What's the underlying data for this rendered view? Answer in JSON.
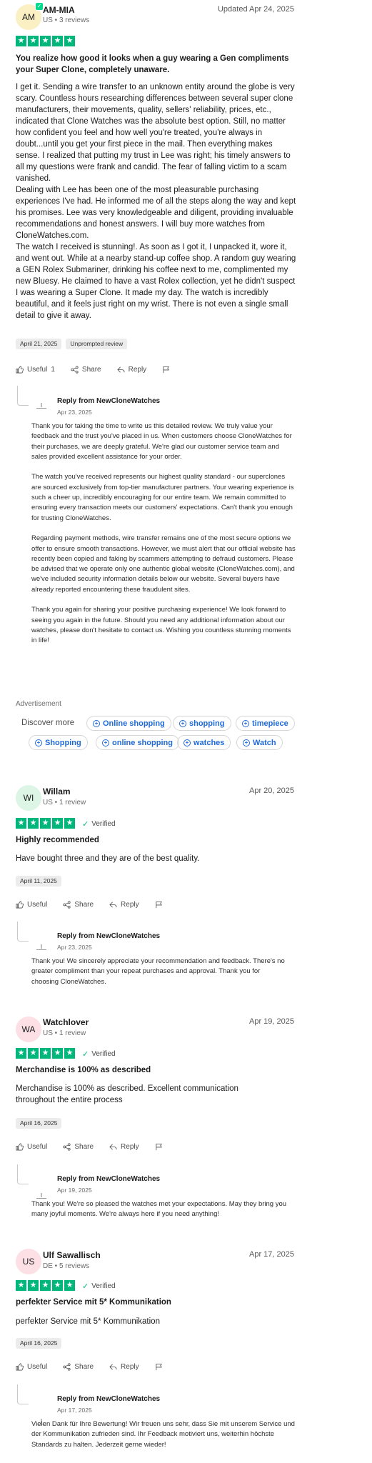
{
  "review1": {
    "initials": "AM",
    "name": "AM-MIA",
    "meta": "US • 3 reviews",
    "date": "Updated Apr 24, 2025",
    "rating": 5,
    "title": "You realize how good it looks when a guy wearing a Gen compliments your Super Clone, completely unaware.",
    "body": "I get it. Sending a wire transfer to an unknown entity around the globe is very scary. Countless hours researching differences between several super clone manufacturers, their movements, quality, sellers' reliability, prices, etc., indicated that Clone Watches was the absolute best option. Still, no matter how confident you feel and how well you're treated, you're always in doubt...until you get your first piece in the mail. Then everything makes sense. I realized that putting my trust in Lee was right; his timely answers to all my questions were frank and candid. The fear of falling victim to a scam vanished.\nDealing with Lee has been one of the most pleasurable purchasing experiences I've had. He informed me of all the steps along the way and kept his promises. Lee was very knowledgeable and diligent, providing invaluable recommendations and honest answers. I will buy more watches from CloneWatches.com.\nThe watch I received is stunning!. As soon as I got it, I unpacked it, wore it, and went out. While at a nearby stand-up coffee shop. A random guy wearing a GEN Rolex Submariner, drinking his coffee next to me, complimented my new Bluesy. He claimed to have a vast Rolex collection, yet he didn't suspect I was wearing a Super Clone. It made my day. The watch is incredibly beautiful, and it feels just right on my wrist. There is not even a single small detail to give it away.",
    "exp_date": "April 21, 2025",
    "tag": "Unprompted review",
    "useful_label": "Useful",
    "useful_count": "1",
    "share": "Share",
    "reply": "Reply",
    "reply_from": "Reply from NewCloneWatches",
    "reply_date": "Apr 23, 2025",
    "reply_text": "Thank you for taking the time to write us this detailed review. We truly value your feedback and the trust you've placed in us. When customers choose CloneWatches for their purchases, we are deeply grateful. We're glad our customer service team and sales provided excellent assistance for your order.\n\nThe watch you've received represents our highest quality standard - our superclones are sourced exclusively from top-tier manufacturer partners. Your wearing experience is such a cheer up, incredibly encouraging for our entire team. We remain committed to ensuring every transaction meets our customers' expectations. Can't thank you enough for trusting CloneWatches.\n\nRegarding payment methods, wire transfer remains one of the most secure options we offer to ensure smooth transactions. However, we must alert that our official website has recently been copied and faking by scammers attempting to defraud customers. Please be advised that we operate only one authentic global website (CloneWatches.com), and we've included security information details below our website. Several buyers have already reported encountering these fraudulent sites.\n\nThank you again for sharing your positive purchasing experience! We look forward to seeing you again in the future. Should you need any additional information about our watches, please don't hesitate to contact us. Wishing you countless stunning moments in life!"
  },
  "ad": {
    "label": "Advertisement",
    "discover": "Discover more",
    "pills": [
      "Online shopping",
      "shopping",
      "timepiece",
      "Shopping",
      "online shopping",
      "watches",
      "Watch"
    ]
  },
  "review2": {
    "initials": "WI",
    "name": "Willam",
    "meta": "US • 1 review",
    "date": "Apr 20, 2025",
    "verified": "Verified",
    "title": "Highly recommended",
    "body": "Have bought three and they are of the best quality.",
    "exp_date": "April 11, 2025",
    "useful_label": "Useful",
    "share": "Share",
    "reply": "Reply",
    "reply_from": "Reply from NewCloneWatches",
    "reply_date": "Apr 23, 2025",
    "reply_text": "Thank you! We sincerely appreciate your recommendation and feedback. There's no greater compliment than your repeat purchases and approval. Thank you for choosing CloneWatches."
  },
  "review3": {
    "initials": "WA",
    "name": "Watchlover",
    "meta": "US • 1 review",
    "date": "Apr 19, 2025",
    "verified": "Verified",
    "title": "Merchandise is 100% as described",
    "body": "Merchandise is 100% as described. Excellent communication throughout the entire process",
    "exp_date": "April 16, 2025",
    "useful_label": "Useful",
    "share": "Share",
    "reply": "Reply",
    "reply_from": "Reply from NewCloneWatches",
    "reply_date": "Apr 19, 2025",
    "reply_text": "Thank you! We're so pleased the watches met your expectations. May they bring you many joyful moments. We're always here if you need anything!"
  },
  "review4": {
    "initials": "US",
    "name": "Ulf Sawallisch",
    "meta": "DE • 5 reviews",
    "date": "Apr 17, 2025",
    "verified": "Verified",
    "title": "perfekter Service mit 5* Kommunikation",
    "body": "perfekter Service mit 5* Kommunikation",
    "exp_date": "April 16, 2025",
    "useful_label": "Useful",
    "share": "Share",
    "reply": "Reply",
    "reply_from": "Reply from NewCloneWatches",
    "reply_date": "Apr 17, 2025",
    "reply_text": "Vielen Dank für Ihre Bewertung! Wir freuen uns sehr, dass Sie mit unserem Service und der Kommunikation zufrieden sind. Ihr Feedback motiviert uns, weiterhin höchste Standards zu halten. Jederzeit gerne wieder!"
  },
  "colors": {
    "star_green": "#00b67a",
    "link_blue": "#1f6ad8",
    "avatar_yellow": "#fbefc4",
    "avatar_green": "#dcf5e4",
    "avatar_pink": "#fce0e6"
  },
  "icons": [
    "thumbs-up-icon",
    "share-icon",
    "reply-arrow-icon",
    "flag-icon",
    "checkmark-icon",
    "star-icon",
    "plus-circle-icon"
  ]
}
